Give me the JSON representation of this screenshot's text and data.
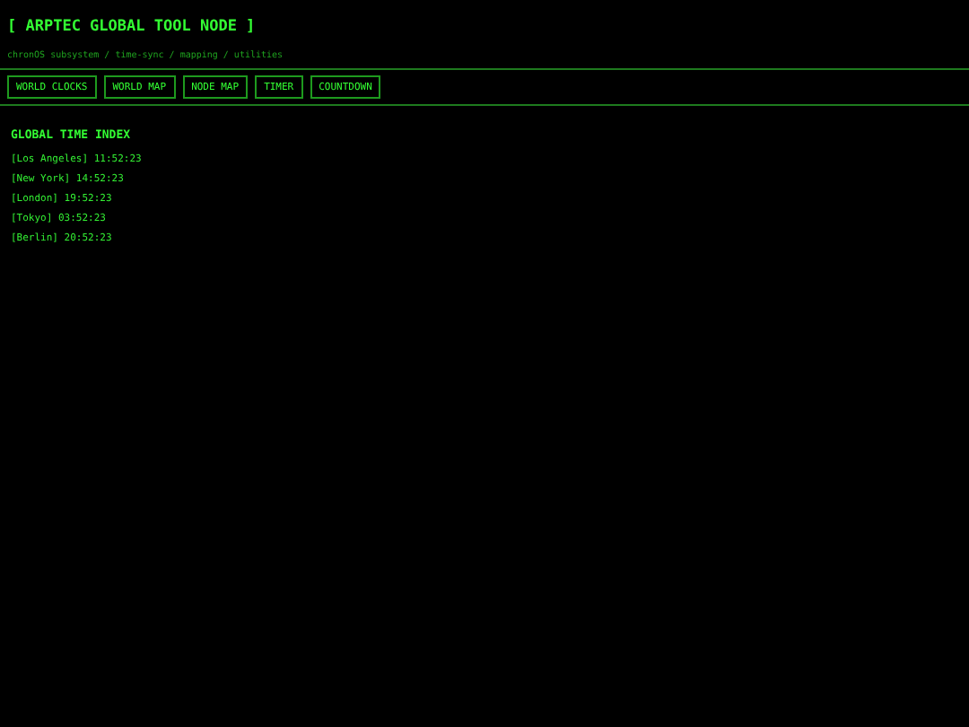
{
  "header": {
    "title": "[ ARPTEC GLOBAL TOOL NODE ]",
    "subtitle": "chronOS subsystem / time-sync / mapping / utilities"
  },
  "nav": [
    "WORLD CLOCKS",
    "WORLD MAP",
    "NODE MAP",
    "TIMER",
    "COUNTDOWN"
  ],
  "section": {
    "heading": "GLOBAL TIME INDEX",
    "entries": [
      "[Los Angeles] 11:52:23",
      "[New York] 14:52:23",
      "[London] 19:52:23",
      "[Tokyo] 03:52:23",
      "[Berlin] 20:52:23"
    ]
  }
}
